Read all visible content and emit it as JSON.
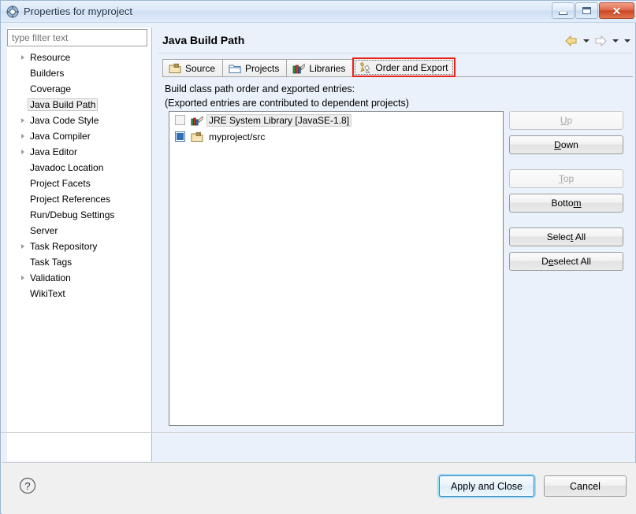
{
  "window": {
    "title": "Properties for myproject",
    "icon": "properties-gear-icon",
    "buttons": {
      "minimize": "minimize-icon",
      "maximize": "maximize-icon",
      "close": "✕"
    }
  },
  "sidebar": {
    "filter": {
      "placeholder": "type filter text",
      "value": ""
    },
    "items": [
      {
        "label": "Resource",
        "expandable": true,
        "selected": false
      },
      {
        "label": "Builders",
        "expandable": false,
        "selected": false
      },
      {
        "label": "Coverage",
        "expandable": false,
        "selected": false
      },
      {
        "label": "Java Build Path",
        "expandable": false,
        "selected": true
      },
      {
        "label": "Java Code Style",
        "expandable": true,
        "selected": false
      },
      {
        "label": "Java Compiler",
        "expandable": true,
        "selected": false
      },
      {
        "label": "Java Editor",
        "expandable": true,
        "selected": false
      },
      {
        "label": "Javadoc Location",
        "expandable": false,
        "selected": false
      },
      {
        "label": "Project Facets",
        "expandable": false,
        "selected": false
      },
      {
        "label": "Project References",
        "expandable": false,
        "selected": false
      },
      {
        "label": "Run/Debug Settings",
        "expandable": false,
        "selected": false
      },
      {
        "label": "Server",
        "expandable": false,
        "selected": false
      },
      {
        "label": "Task Repository",
        "expandable": true,
        "selected": false
      },
      {
        "label": "Task Tags",
        "expandable": false,
        "selected": false
      },
      {
        "label": "Validation",
        "expandable": true,
        "selected": false
      },
      {
        "label": "WikiText",
        "expandable": false,
        "selected": false
      }
    ]
  },
  "page": {
    "title": "Java Build Path",
    "nav": {
      "back": "back-arrow-icon",
      "back_menu": "chevron-down-icon",
      "forward": "forward-arrow-icon",
      "forward_menu": "chevron-down-icon",
      "view_menu": "chevron-down-icon"
    },
    "tabs": [
      {
        "label": "Source",
        "icon": "source-folder-icon",
        "active": false
      },
      {
        "label": "Projects",
        "icon": "projects-folder-icon",
        "active": false
      },
      {
        "label": "Libraries",
        "icon": "libraries-books-icon",
        "active": false
      },
      {
        "label": "Order and Export",
        "icon": "order-export-icon",
        "active": true
      }
    ],
    "description_line1_a": "Build class path order and e",
    "description_line1_mnemonic": "x",
    "description_line1_b": "ported entries:",
    "description_line2": "(Exported entries are contributed to dependent projects)",
    "entries": [
      {
        "label": "JRE System Library [JavaSE-1.8]",
        "checked": false,
        "selected": true,
        "icon": "jre-library-icon"
      },
      {
        "label": "myproject/src",
        "checked": true,
        "selected": false,
        "icon": "source-folder-icon"
      }
    ],
    "side_buttons": [
      {
        "id": "up",
        "pre": "U",
        "mnemonic": "",
        "label_pre": "",
        "text": "Up",
        "mn_index": 0,
        "disabled": true
      },
      {
        "id": "down",
        "text": "Down",
        "mn_index": 0,
        "disabled": false
      },
      {
        "id": "top",
        "text": "Top",
        "mn_index": 0,
        "disabled": true
      },
      {
        "id": "bottom",
        "text": "Bottom",
        "mn_index": 5,
        "disabled": false
      },
      {
        "id": "select-all",
        "text": "Select All",
        "mn_index": 5,
        "disabled": false
      },
      {
        "id": "deselect-all",
        "text": "Deselect All",
        "mn_index": 1,
        "disabled": false
      }
    ],
    "apply_label": "Apply",
    "apply_mn_index": 0
  },
  "footer": {
    "help": "help-question-icon",
    "apply_and_close": "Apply and Close",
    "cancel": "Cancel"
  },
  "colors": {
    "highlight_red": "#e8211b",
    "titlebar_blue": "#cfe0f3",
    "checkbox_checked": "#2f6fb5",
    "accent_focus": "#9ddcf5"
  }
}
